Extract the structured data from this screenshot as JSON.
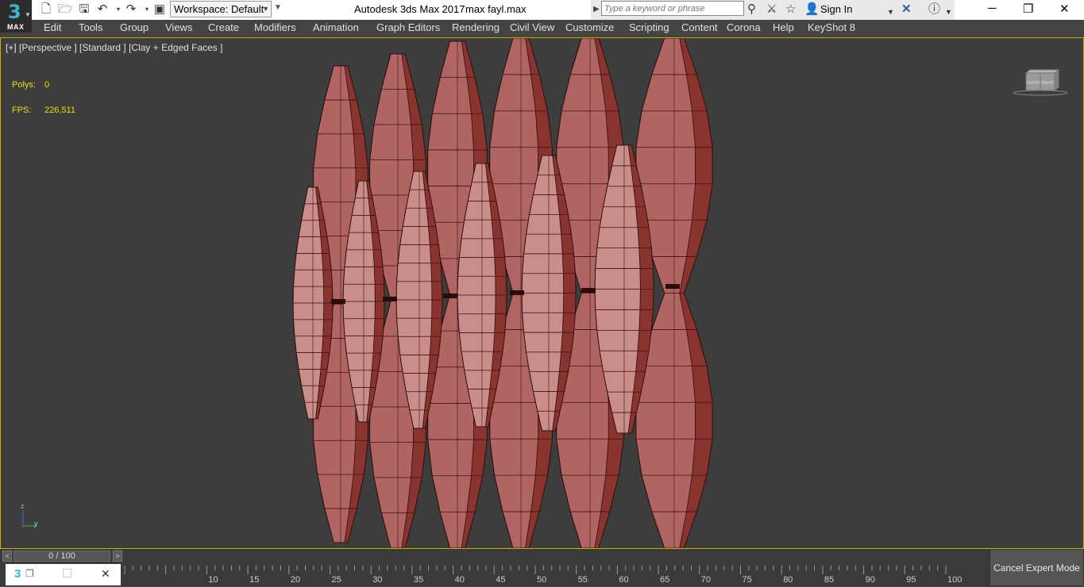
{
  "titlebar": {
    "logo_text": "3",
    "logo_sub": "MAX",
    "workspace_label": "Workspace: Default",
    "app_title": "Autodesk 3ds Max 2017",
    "file_name": "max fayl.max",
    "search_placeholder": "Type a keyword or phrase",
    "sign_in": "Sign In"
  },
  "menubar": {
    "items": [
      "Edit",
      "Tools",
      "Group",
      "Views",
      "Create",
      "Modifiers",
      "Animation",
      "Graph Editors",
      "Rendering",
      "Civil View",
      "Customize",
      "Scripting",
      "Content",
      "Corona",
      "Help",
      "KeyShot 8"
    ]
  },
  "viewport": {
    "label": "[+] [Perspective ] [Standard ] [Clay + Edged Faces ]",
    "polys_label": "Polys:",
    "polys_value": "0",
    "fps_label": "FPS:",
    "fps_value": "226,511",
    "viewcube_text": "FRONT RIGHT",
    "axis_z": "z",
    "axis_y": "y"
  },
  "timeline": {
    "position": "0 / 100",
    "current_frame": 0,
    "total_frames": 100,
    "ticks": [
      "10",
      "15",
      "20",
      "25",
      "30",
      "35",
      "40",
      "45",
      "50",
      "55",
      "60",
      "65",
      "70",
      "75",
      "80",
      "85",
      "90",
      "95",
      "100"
    ]
  },
  "buttons": {
    "cancel_expert_mode": "Cancel Expert Mode"
  },
  "colors": {
    "ui_dark": "#444444",
    "viewport_bg": "#3d3d3d",
    "viewport_border": "#c8b400",
    "stat_text": "#e8e000",
    "model_light": "#c98d8a",
    "model_mid": "#b06563",
    "model_dark": "#8a3430"
  }
}
